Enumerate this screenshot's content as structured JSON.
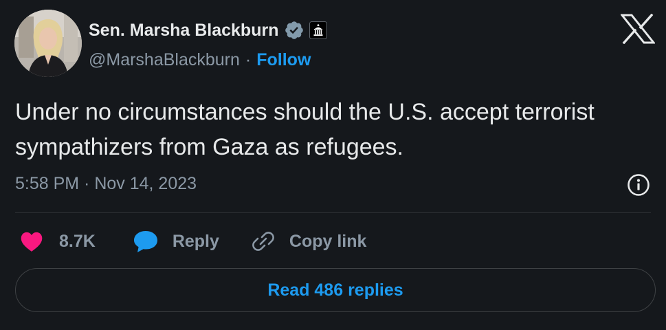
{
  "author": {
    "name": "Sen. Marsha Blackburn",
    "handle": "@MarshaBlackburn",
    "separator": "·",
    "follow_label": "Follow",
    "verified_icon": "verified-badge-icon",
    "affiliation_icon": "government-building-icon"
  },
  "tweet": {
    "text": "Under no circumstances should the U.S. accept terrorist sympathizers from Gaza as refugees.",
    "timestamp": "5:58 PM · Nov 14, 2023"
  },
  "actions": {
    "like_count": "8.7K",
    "reply_label": "Reply",
    "copy_link_label": "Copy link"
  },
  "footer": {
    "read_replies_label": "Read 486 replies"
  },
  "colors": {
    "background": "#15181c",
    "text": "#e7e9ea",
    "muted": "#8b98a5",
    "accent": "#1d9bf0",
    "like": "#f91880",
    "verified": "#829aab"
  }
}
